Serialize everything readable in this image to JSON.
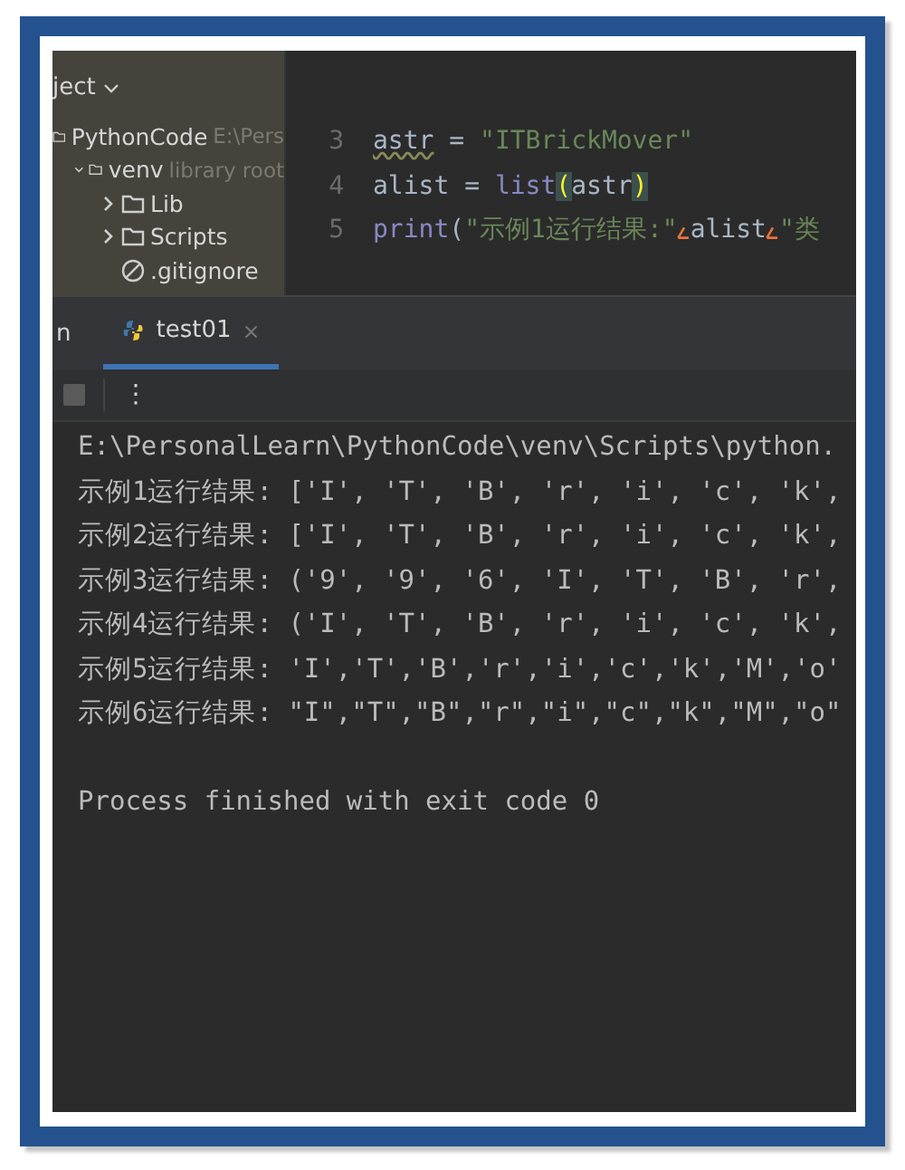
{
  "sidebar": {
    "header": "ject",
    "tree": [
      {
        "label": "PythonCode",
        "hint": "E:\\Pers",
        "kind": "folder",
        "children": [
          {
            "label": "venv",
            "hint": "library root",
            "kind": "folder",
            "expanded": true,
            "children": [
              {
                "label": "Lib",
                "kind": "folder",
                "expanded": false
              },
              {
                "label": "Scripts",
                "kind": "folder",
                "expanded": false
              },
              {
                "label": ".gitignore",
                "kind": "ignored-file"
              }
            ]
          }
        ]
      }
    ]
  },
  "editor": {
    "lines": [
      {
        "number": "3",
        "tokens": [
          {
            "kind": "warned",
            "text": "astr"
          },
          {
            "kind": "plain",
            "text": " = "
          },
          {
            "kind": "string",
            "text": "\"ITBrickMover\""
          }
        ]
      },
      {
        "number": "4",
        "tokens": [
          {
            "kind": "plain",
            "text": "alist = "
          },
          {
            "kind": "builtin",
            "text": "list"
          },
          {
            "kind": "brace",
            "text": "("
          },
          {
            "kind": "plain",
            "text": "astr"
          },
          {
            "kind": "brace",
            "text": ")"
          }
        ]
      },
      {
        "number": "5",
        "tokens": [
          {
            "kind": "builtin",
            "text": "print"
          },
          {
            "kind": "plain",
            "text": "("
          },
          {
            "kind": "string",
            "text": "\"示例1运行结果:\""
          },
          {
            "kind": "hint"
          },
          {
            "kind": "plain",
            "text": "alist"
          },
          {
            "kind": "hint"
          },
          {
            "kind": "string",
            "text": "\"类"
          }
        ]
      }
    ]
  },
  "run_panel": {
    "title": "n",
    "tabs": [
      {
        "label": "test01",
        "selected": true,
        "close": "×"
      }
    ],
    "toolbar": {
      "more": "⋮"
    },
    "output": [
      "E:\\PersonalLearn\\PythonCode\\venv\\Scripts\\python.",
      "示例1运行结果: ['I', 'T', 'B', 'r', 'i', 'c', 'k',",
      "示例2运行结果: ['I', 'T', 'B', 'r', 'i', 'c', 'k',",
      "示例3运行结果: ('9', '9', '6', 'I', 'T', 'B', 'r',",
      "示例4运行结果: ('I', 'T', 'B', 'r', 'i', 'c', 'k',",
      "示例5运行结果: 'I','T','B','r','i','c','k','M','o'",
      "示例6运行结果: \"I\",\"T\",\"B\",\"r\",\"i\",\"c\",\"k\",\"M\",\"o\""
    ],
    "exit_message": "Process finished with exit code 0"
  }
}
